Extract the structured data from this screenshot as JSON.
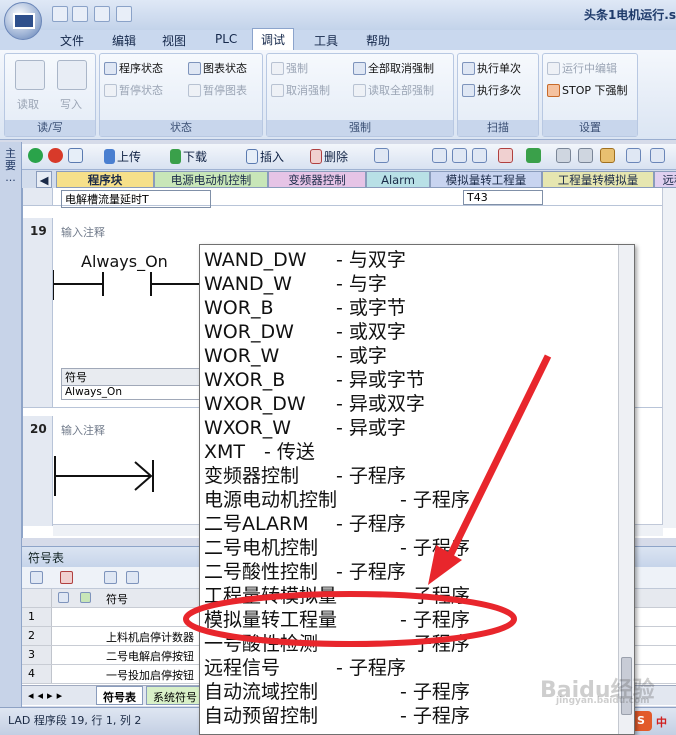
{
  "window": {
    "title": "头条1电机运行.s"
  },
  "menus": [
    "文件",
    "编辑",
    "视图",
    "PLC",
    "调试",
    "工具",
    "帮助"
  ],
  "active_menu": "调试",
  "ribbon": {
    "groups": [
      {
        "title": "读/写",
        "big": [
          "读取",
          "写入"
        ]
      },
      {
        "title": "状态",
        "items": [
          "程序状态",
          "暂停状态",
          "图表状态",
          "暂停图表"
        ]
      },
      {
        "title": "强制",
        "items": [
          "强制",
          "取消强制",
          "全部取消强制",
          "读取全部强制"
        ]
      },
      {
        "title": "扫描",
        "items": [
          "执行单次",
          "执行多次"
        ]
      },
      {
        "title": "设置",
        "items": [
          "运行中编辑",
          "STOP 下强制"
        ]
      }
    ]
  },
  "left_strip": "主要 ...",
  "toolbar": {
    "upload": "上传",
    "download": "下载",
    "insert": "插入",
    "delete": "删除"
  },
  "tabs": [
    "程序块",
    "电源电动机控制",
    "变频器控制",
    "Alarm",
    "模拟量转工程量",
    "工程量转模拟量",
    "远程"
  ],
  "editor": {
    "prev_comment": "电解槽流量延时T",
    "prev_ref": "T43",
    "network19": {
      "num": "19",
      "hint": "输入注释",
      "contact": "Always_On",
      "sym_header": "符号",
      "sym_value": "Always_On"
    },
    "network20": {
      "num": "20",
      "hint": "输入注释"
    }
  },
  "symbol_table": {
    "title": "符号表",
    "col_symbol": "符号",
    "rows": [
      {
        "n": "1",
        "sym": ""
      },
      {
        "n": "2",
        "sym": "上料机启停计数器"
      },
      {
        "n": "3",
        "sym": "二号电解启停按钮"
      },
      {
        "n": "4",
        "sym": "一号投加启停按钮"
      }
    ],
    "sheets": [
      "符号表",
      "系统符号"
    ]
  },
  "status": "LAD 程序段 19, 行 1, 列 2",
  "popup_items": [
    {
      "name": "WAND_DW",
      "desc": "- 与双字"
    },
    {
      "name": "WAND_W",
      "desc": "- 与字"
    },
    {
      "name": "WOR_B",
      "desc": "- 或字节"
    },
    {
      "name": "WOR_DW",
      "desc": "- 或双字"
    },
    {
      "name": "WOR_W",
      "desc": "- 或字"
    },
    {
      "name": "WXOR_B",
      "desc": "- 异或字节"
    },
    {
      "name": "WXOR_DW",
      "desc": "- 异或双字"
    },
    {
      "name": "WXOR_W",
      "desc": "- 异或字"
    },
    {
      "name": "XMT",
      "desc": "- 传送"
    },
    {
      "name": "变频器控制",
      "desc": "- 子程序"
    },
    {
      "name": "电源电动机控制",
      "desc": "- 子程序"
    },
    {
      "name": "二号ALARM",
      "desc": "- 子程序"
    },
    {
      "name": "二号电机控制",
      "desc": "- 子程序"
    },
    {
      "name": "二号酸性控制",
      "desc": "- 子程序"
    },
    {
      "name": "工程量转模拟量",
      "desc": "- 子程序"
    },
    {
      "name": "模拟量转工程量",
      "desc": "- 子程序"
    },
    {
      "name": "一号酸性检测",
      "desc": "- 子程序"
    },
    {
      "name": "远程信号",
      "desc": "- 子程序"
    },
    {
      "name": "自动流域控制",
      "desc": "- 子程序"
    },
    {
      "name": "自动预留控制",
      "desc": "- 子程序"
    }
  ],
  "highlight_color": "#e8262c",
  "watermark": "Baidu经验",
  "watermark_sub": "jingyan.baidu.com",
  "ime": "中"
}
